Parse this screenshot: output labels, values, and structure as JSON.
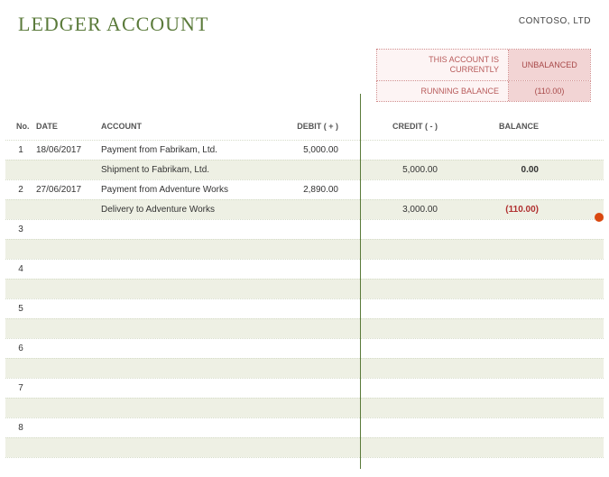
{
  "header": {
    "title": "LEDGER ACCOUNT",
    "company": "CONTOSO, LTD"
  },
  "status": {
    "label1": "THIS ACCOUNT IS CURRENTLY",
    "value1": "UNBALANCED",
    "label2": "RUNNING BALANCE",
    "value2": "(110.00)"
  },
  "columns": {
    "no": "No.",
    "date": "DATE",
    "account": "ACCOUNT",
    "debit": "DEBIT ( + )",
    "credit": "CREDIT ( - )",
    "balance": "BALANCE"
  },
  "rows": [
    {
      "no": "1",
      "date": "18/06/2017",
      "account": "Payment from Fabrikam, Ltd.",
      "debit": "5,000.00",
      "credit": "",
      "balance": "",
      "neg": false
    },
    {
      "no": "",
      "date": "",
      "account": "Shipment to Fabrikam, Ltd.",
      "debit": "",
      "credit": "5,000.00",
      "balance": "0.00",
      "neg": false
    },
    {
      "no": "2",
      "date": "27/06/2017",
      "account": "Payment from Adventure Works",
      "debit": "2,890.00",
      "credit": "",
      "balance": "",
      "neg": false
    },
    {
      "no": "",
      "date": "",
      "account": "Delivery to Adventure Works",
      "debit": "",
      "credit": "3,000.00",
      "balance": "(110.00)",
      "neg": true
    },
    {
      "no": "3",
      "date": "",
      "account": "",
      "debit": "",
      "credit": "",
      "balance": "",
      "neg": false
    },
    {
      "no": "",
      "date": "",
      "account": "",
      "debit": "",
      "credit": "",
      "balance": "",
      "neg": false
    },
    {
      "no": "4",
      "date": "",
      "account": "",
      "debit": "",
      "credit": "",
      "balance": "",
      "neg": false
    },
    {
      "no": "",
      "date": "",
      "account": "",
      "debit": "",
      "credit": "",
      "balance": "",
      "neg": false
    },
    {
      "no": "5",
      "date": "",
      "account": "",
      "debit": "",
      "credit": "",
      "balance": "",
      "neg": false
    },
    {
      "no": "",
      "date": "",
      "account": "",
      "debit": "",
      "credit": "",
      "balance": "",
      "neg": false
    },
    {
      "no": "6",
      "date": "",
      "account": "",
      "debit": "",
      "credit": "",
      "balance": "",
      "neg": false
    },
    {
      "no": "",
      "date": "",
      "account": "",
      "debit": "",
      "credit": "",
      "balance": "",
      "neg": false
    },
    {
      "no": "7",
      "date": "",
      "account": "",
      "debit": "",
      "credit": "",
      "balance": "",
      "neg": false
    },
    {
      "no": "",
      "date": "",
      "account": "",
      "debit": "",
      "credit": "",
      "balance": "",
      "neg": false
    },
    {
      "no": "8",
      "date": "",
      "account": "",
      "debit": "",
      "credit": "",
      "balance": "",
      "neg": false
    },
    {
      "no": "",
      "date": "",
      "account": "",
      "debit": "",
      "credit": "",
      "balance": "",
      "neg": false
    },
    {
      "no": "",
      "date": "",
      "account": "",
      "debit": "",
      "credit": "",
      "balance": "",
      "neg": false
    }
  ],
  "chart_data": {
    "type": "table",
    "title": "Ledger Account",
    "columns": [
      "No.",
      "Date",
      "Account",
      "Debit (+)",
      "Credit (-)",
      "Balance"
    ],
    "rows": [
      [
        1,
        "18/06/2017",
        "Payment from Fabrikam, Ltd.",
        5000.0,
        null,
        null
      ],
      [
        null,
        null,
        "Shipment to Fabrikam, Ltd.",
        null,
        5000.0,
        0.0
      ],
      [
        2,
        "27/06/2017",
        "Payment from Adventure Works",
        2890.0,
        null,
        null
      ],
      [
        null,
        null,
        "Delivery to Adventure Works",
        null,
        3000.0,
        -110.0
      ]
    ],
    "running_balance": -110.0,
    "status": "UNBALANCED"
  }
}
